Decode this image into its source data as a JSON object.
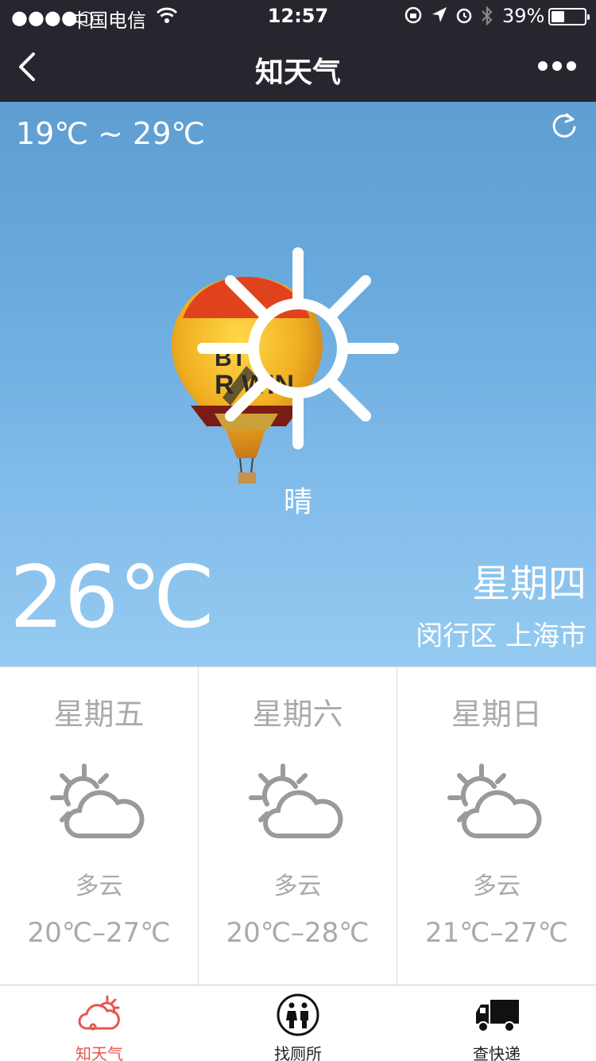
{
  "status_bar": {
    "signal": "●●●●○",
    "carrier": "中国电信",
    "time": "12:57",
    "battery": "39%",
    "battery_level": 0.39
  },
  "nav": {
    "title": "知天气",
    "back_icon": "chevron-left-icon",
    "more_icon": "more-dots-icon"
  },
  "today": {
    "temp_range": "19℃ ~ 29℃",
    "condition": "晴",
    "condition_icon": "sun-icon",
    "current_temp": "26℃",
    "weekday": "星期四",
    "location": "闵行区 上海市"
  },
  "forecast": [
    {
      "day": "星期五",
      "condition": "多云",
      "icon": "partly-cloudy-icon",
      "range": "20℃–27℃"
    },
    {
      "day": "星期六",
      "condition": "多云",
      "icon": "partly-cloudy-icon",
      "range": "20℃–28℃"
    },
    {
      "day": "星期日",
      "condition": "多云",
      "icon": "partly-cloudy-icon",
      "range": "21℃–27℃"
    }
  ],
  "tabs": [
    {
      "label": "知天气",
      "icon": "weather-icon",
      "active": true,
      "color": "#e5574f"
    },
    {
      "label": "找厕所",
      "icon": "restroom-icon",
      "active": false
    },
    {
      "label": "查快递",
      "icon": "truck-icon",
      "active": false
    }
  ]
}
